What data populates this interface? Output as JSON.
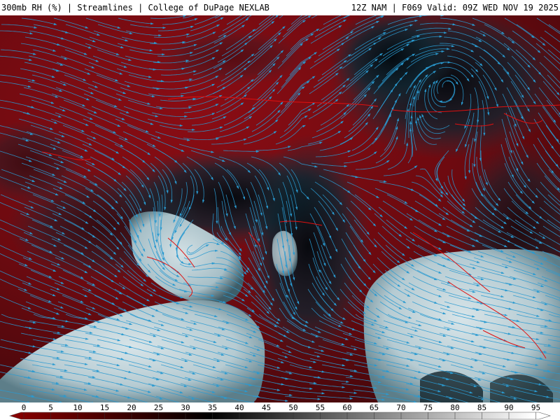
{
  "header": {
    "left_title": "300mb RH (%) | Streamlines | College of DuPage NEXLAB",
    "right_title": "12Z NAM | F069 Valid: 09Z WED NOV 19 2025"
  },
  "map": {
    "field": "300mb RH (%)",
    "overlay": "Streamlines",
    "colors": {
      "dry": "#7a0a10",
      "mid": "#0c1a22",
      "moist": "#c9d9de",
      "streamline": "#2a9ad0",
      "coastline": "#e01010"
    }
  },
  "legend": {
    "ticks": [
      "0",
      "5",
      "10",
      "15",
      "20",
      "25",
      "30",
      "35",
      "40",
      "45",
      "50",
      "55",
      "60",
      "65",
      "70",
      "75",
      "80",
      "85",
      "90",
      "95"
    ],
    "colors": {
      "start": "#8b0000",
      "black": "#000000",
      "end": "#ffffff"
    }
  }
}
